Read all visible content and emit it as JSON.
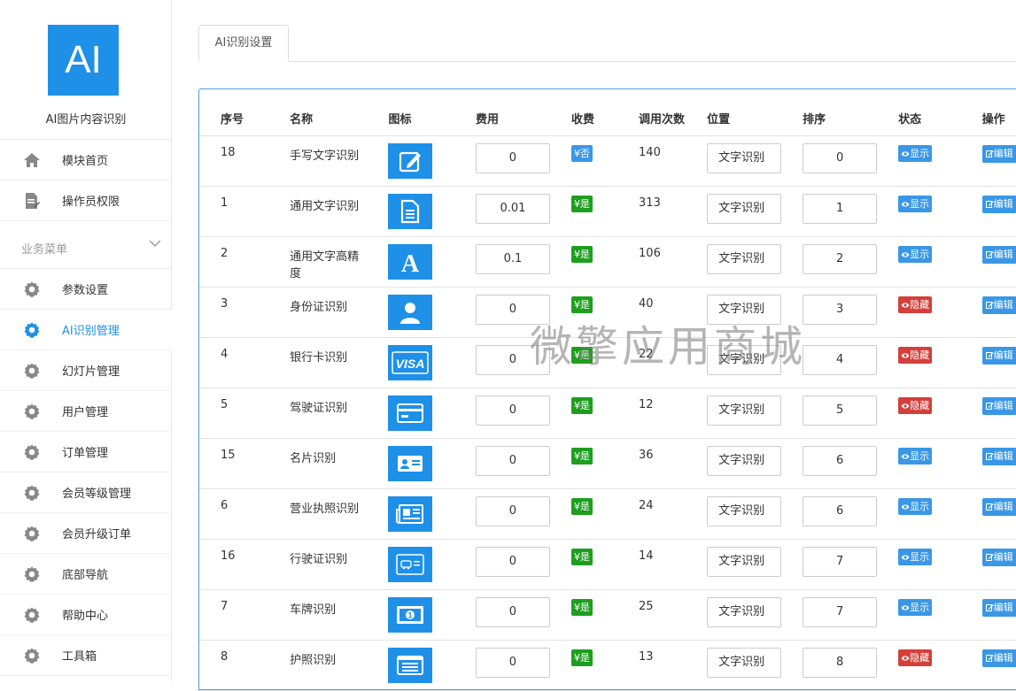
{
  "sidebar": {
    "logo_text": "AI",
    "app_name": "AI图片内容识别",
    "top_items": [
      {
        "label": "模块首页",
        "icon": "home-icon"
      },
      {
        "label": "操作员权限",
        "icon": "document-edit-icon"
      }
    ],
    "section_label": "业务菜单",
    "items": [
      {
        "label": "参数设置"
      },
      {
        "label": "AI识别管理",
        "active": true
      },
      {
        "label": "幻灯片管理"
      },
      {
        "label": "用户管理"
      },
      {
        "label": "订单管理"
      },
      {
        "label": "会员等级管理"
      },
      {
        "label": "会员升级订单"
      },
      {
        "label": "底部导航"
      },
      {
        "label": "帮助中心"
      },
      {
        "label": "工具箱"
      }
    ]
  },
  "tab": {
    "label": "AI识别设置"
  },
  "table": {
    "headers": {
      "id": "序号",
      "name": "名称",
      "icon": "图标",
      "fee": "费用",
      "charge": "收费",
      "calls": "调用次数",
      "position": "位置",
      "sort": "排序",
      "status": "状态",
      "action": "操作"
    },
    "rows": [
      {
        "id": "18",
        "name": "手写文字识别",
        "icon": "pencil-icon",
        "fee": "0",
        "charge": "¥否",
        "calls": "140",
        "position": "文字识别",
        "sort": "0",
        "status": "显示",
        "action": "编辑"
      },
      {
        "id": "1",
        "name": "通用文字识别",
        "icon": "document-icon",
        "fee": "0.01",
        "charge": "¥是",
        "calls": "313",
        "position": "文字识别",
        "sort": "1",
        "status": "显示",
        "action": "编辑"
      },
      {
        "id": "2",
        "name": "通用文字高精度",
        "icon": "letter-a-icon",
        "fee": "0.1",
        "charge": "¥是",
        "calls": "106",
        "position": "文字识别",
        "sort": "2",
        "status": "显示",
        "action": "编辑"
      },
      {
        "id": "3",
        "name": "身份证识别",
        "icon": "person-card-icon",
        "fee": "0",
        "charge": "¥是",
        "calls": "40",
        "position": "文字识别",
        "sort": "3",
        "status": "隐藏",
        "action": "编辑"
      },
      {
        "id": "4",
        "name": "银行卡识别",
        "icon": "visa-icon",
        "fee": "0",
        "charge": "¥是",
        "calls": "22",
        "position": "文字识别",
        "sort": "4",
        "status": "隐藏",
        "action": "编辑"
      },
      {
        "id": "5",
        "name": "驾驶证识别",
        "icon": "credit-card-icon",
        "fee": "0",
        "charge": "¥是",
        "calls": "12",
        "position": "文字识别",
        "sort": "5",
        "status": "隐藏",
        "action": "编辑"
      },
      {
        "id": "15",
        "name": "名片识别",
        "icon": "business-card-icon",
        "fee": "0",
        "charge": "¥是",
        "calls": "36",
        "position": "文字识别",
        "sort": "6",
        "status": "显示",
        "action": "编辑"
      },
      {
        "id": "6",
        "name": "营业执照识别",
        "icon": "newspaper-icon",
        "fee": "0",
        "charge": "¥是",
        "calls": "24",
        "position": "文字识别",
        "sort": "6",
        "status": "显示",
        "action": "编辑"
      },
      {
        "id": "16",
        "name": "行驶证识别",
        "icon": "car-license-icon",
        "fee": "0",
        "charge": "¥是",
        "calls": "14",
        "position": "文字识别",
        "sort": "7",
        "status": "显示",
        "action": "编辑"
      },
      {
        "id": "7",
        "name": "车牌识别",
        "icon": "money-icon",
        "fee": "0",
        "charge": "¥是",
        "calls": "25",
        "position": "文字识别",
        "sort": "7",
        "status": "显示",
        "action": "编辑"
      },
      {
        "id": "8",
        "name": "护照识别",
        "icon": "list-card-icon",
        "fee": "0",
        "charge": "¥是",
        "calls": "13",
        "position": "文字识别",
        "sort": "8",
        "status": "隐藏",
        "action": "编辑"
      }
    ]
  },
  "watermark": "微擎应用商城",
  "colors": {
    "primary": "#1e90e8",
    "green": "#1e9e1e",
    "red": "#d43f3a",
    "blue_badge": "#3a97e6"
  }
}
